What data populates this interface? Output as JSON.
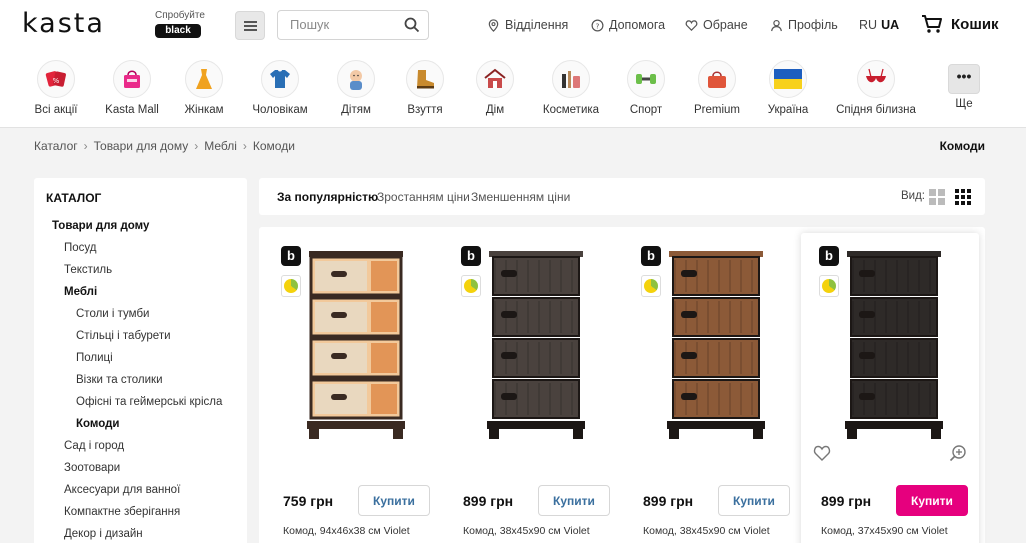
{
  "header": {
    "logo": "kasta",
    "promo_text": "Спробуйте",
    "promo_badge": "black",
    "search_placeholder": "Пошук",
    "links": {
      "branches": "Відділення",
      "help": "Допомога",
      "favorites": "Обране",
      "profile": "Профіль"
    },
    "lang_ru": "RU",
    "lang_ua": "UA",
    "cart": "Кошик"
  },
  "categories": [
    {
      "label": "Всі акції",
      "icon": "sale-tags-icon"
    },
    {
      "label": "Kasta Mall",
      "icon": "shopping-bag-icon"
    },
    {
      "label": "Жінкам",
      "icon": "dress-icon"
    },
    {
      "label": "Чоловікам",
      "icon": "tshirt-icon"
    },
    {
      "label": "Дітям",
      "icon": "baby-icon"
    },
    {
      "label": "Взуття",
      "icon": "boot-icon"
    },
    {
      "label": "Дім",
      "icon": "house-icon"
    },
    {
      "label": "Косметика",
      "icon": "cosmetics-icon"
    },
    {
      "label": "Спорт",
      "icon": "dumbbell-icon"
    },
    {
      "label": "Premium",
      "icon": "handbag-icon"
    },
    {
      "label": "Україна",
      "icon": "ukraine-flag-icon"
    },
    {
      "label": "Спідня білизна",
      "icon": "lingerie-icon"
    },
    {
      "label": "Ще",
      "icon": "more-icon"
    }
  ],
  "breadcrumb": [
    "Каталог",
    "Товари для дому",
    "Меблі",
    "Комоди"
  ],
  "page_title": "Комоди",
  "sidebar": {
    "title": "КАТАЛОГ",
    "items": [
      {
        "label": "Товари для дому",
        "level": 0,
        "bold": true
      },
      {
        "label": "Посуд",
        "level": 1,
        "bold": false
      },
      {
        "label": "Текстиль",
        "level": 1,
        "bold": false
      },
      {
        "label": "Меблі",
        "level": 1,
        "bold": true
      },
      {
        "label": "Столи і тумби",
        "level": 2,
        "bold": false
      },
      {
        "label": "Стільці і табурети",
        "level": 2,
        "bold": false
      },
      {
        "label": "Полиці",
        "level": 2,
        "bold": false
      },
      {
        "label": "Візки та столики",
        "level": 2,
        "bold": false
      },
      {
        "label": "Офісні та геймерські крісла",
        "level": 2,
        "bold": false
      },
      {
        "label": "Комоди",
        "level": 2,
        "bold": true
      },
      {
        "label": "Сад і город",
        "level": 1,
        "bold": false
      },
      {
        "label": "Зоотовари",
        "level": 1,
        "bold": false
      },
      {
        "label": "Аксесуари для ванної",
        "level": 1,
        "bold": false
      },
      {
        "label": "Компактне зберігання",
        "level": 1,
        "bold": false
      },
      {
        "label": "Декор і дизайн",
        "level": 1,
        "bold": false
      }
    ]
  },
  "sort": {
    "popular": "За популярністю",
    "asc": "Зростанням ціни",
    "desc": "Зменшенням ціни",
    "view_label": "Вид:"
  },
  "products": [
    {
      "price": "759 грн",
      "buy": "Купити",
      "name": "Комод, 94x46x38 см Violet",
      "style": "decor",
      "color": "#e8a66b"
    },
    {
      "price": "899 грн",
      "buy": "Купити",
      "name": "Комод, 38x45x90 см Violet",
      "style": "rattan",
      "color": "#4a423e"
    },
    {
      "price": "899 грн",
      "buy": "Купити",
      "name": "Комод, 38x45x90 см Violet",
      "style": "rattan",
      "color": "#8c5a38"
    },
    {
      "price": "899 грн",
      "buy": "Купити",
      "name": "Комод, 37x45x90 см Violet",
      "style": "rattan",
      "color": "#2e2a28"
    }
  ],
  "colors": {
    "accent": "#e6007e",
    "link": "#3a6f9e"
  }
}
